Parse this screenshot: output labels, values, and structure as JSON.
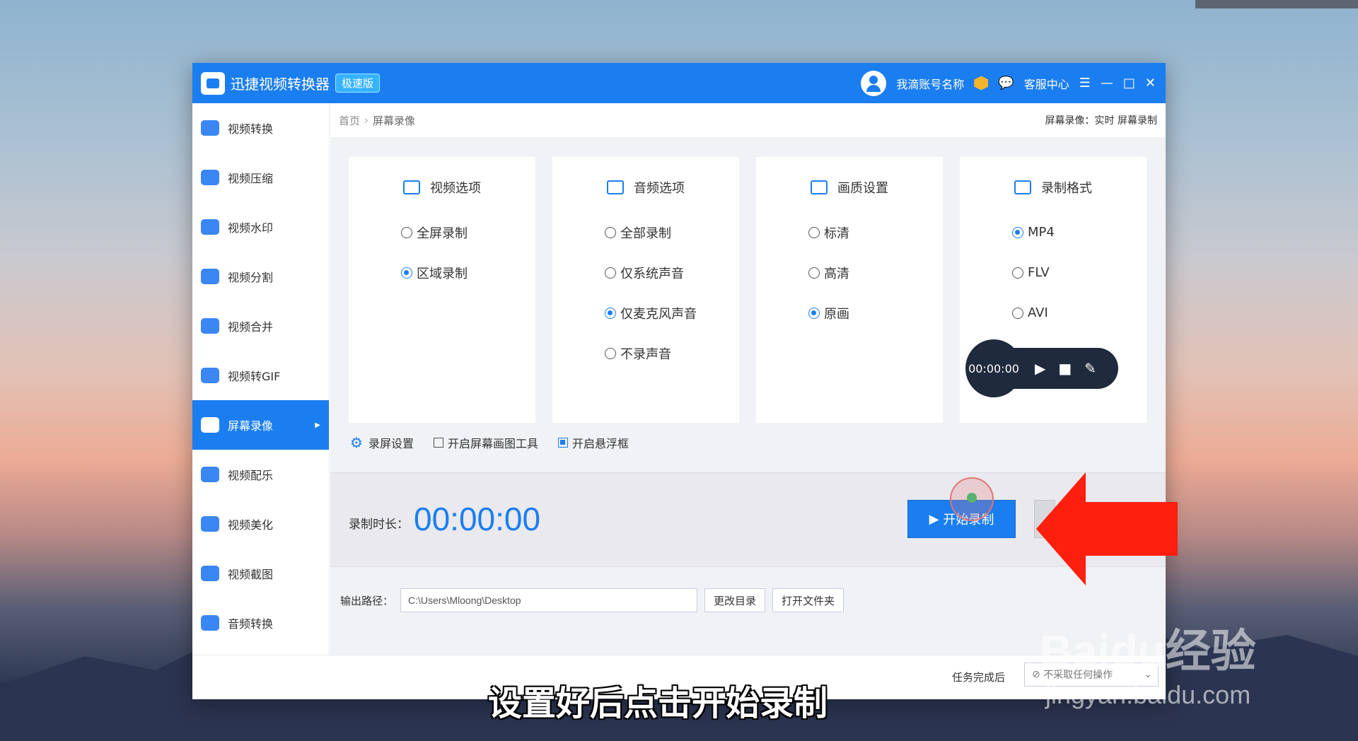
{
  "app": {
    "title": "迅捷视频转换器",
    "badge": "极速版",
    "account": "我滴账号名称",
    "service": "客服中心"
  },
  "sidebar": {
    "items": [
      {
        "label": "视频转换",
        "icon": "video-convert-icon"
      },
      {
        "label": "视频压缩",
        "icon": "compress-icon"
      },
      {
        "label": "视频水印",
        "icon": "watermark-icon"
      },
      {
        "label": "视频分割",
        "icon": "split-icon"
      },
      {
        "label": "视频合并",
        "icon": "merge-icon"
      },
      {
        "label": "视频转GIF",
        "icon": "gif-icon"
      },
      {
        "label": "屏幕录像",
        "icon": "screen-record-icon",
        "active": true
      },
      {
        "label": "视频配乐",
        "icon": "music-icon"
      },
      {
        "label": "视频美化",
        "icon": "beautify-icon"
      },
      {
        "label": "视频截图",
        "icon": "screenshot-icon"
      },
      {
        "label": "音频转换",
        "icon": "audio-convert-icon"
      }
    ]
  },
  "breadcrumb": {
    "home": "首页",
    "current": "屏幕录像",
    "right": "屏幕录像：实时 屏幕录制"
  },
  "cards": [
    {
      "title": "视频选项",
      "options": [
        {
          "label": "全屏录制",
          "checked": false
        },
        {
          "label": "区域录制",
          "checked": true
        }
      ]
    },
    {
      "title": "音频选项",
      "options": [
        {
          "label": "全部录制",
          "checked": false
        },
        {
          "label": "仅系统声音",
          "checked": false
        },
        {
          "label": "仅麦克风声音",
          "checked": true
        },
        {
          "label": "不录声音",
          "checked": false
        }
      ]
    },
    {
      "title": "画质设置",
      "options": [
        {
          "label": "标清",
          "checked": false
        },
        {
          "label": "高清",
          "checked": false
        },
        {
          "label": "原画",
          "checked": true
        }
      ]
    },
    {
      "title": "录制格式",
      "options": [
        {
          "label": "MP4",
          "checked": true
        },
        {
          "label": "FLV",
          "checked": false
        },
        {
          "label": "AVI",
          "checked": false
        }
      ]
    }
  ],
  "float_timer": "00:00:00",
  "settings": {
    "record_settings": "录屏设置",
    "draw_tool": "开启屏幕画图工具",
    "floating": "开启悬浮框"
  },
  "record": {
    "label": "录制时长：",
    "time": "00:00:00",
    "start_label": "开始录制"
  },
  "output": {
    "label": "输出路径：",
    "path": "C:\\Users\\Mloong\\Desktop",
    "change_dir": "更改目录",
    "open_folder": "打开文件夹"
  },
  "footer": {
    "label": "任务完成后",
    "select_value": "不采取任何操作"
  },
  "caption": "设置好后点击开始录制",
  "watermark": {
    "brand": "Baidu经验",
    "url": "jingyan.baidu.com"
  },
  "colors": {
    "accent": "#1b7ef0",
    "arrow": "#ff1f0f"
  }
}
